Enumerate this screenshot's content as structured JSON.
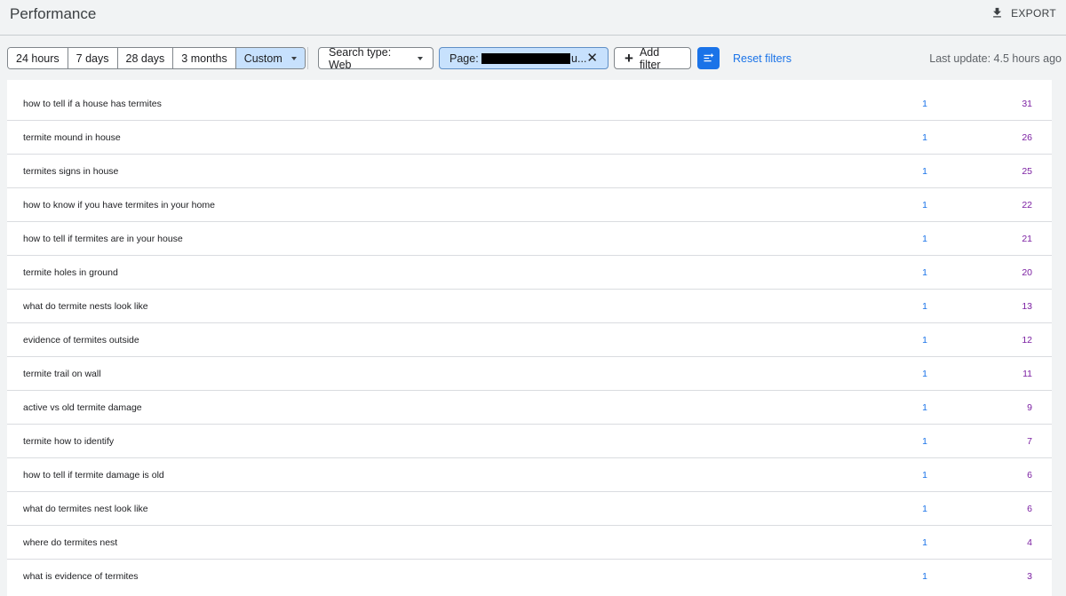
{
  "header": {
    "title": "Performance",
    "export_label": "EXPORT"
  },
  "filters": {
    "date_ranges": [
      {
        "label": "24 hours",
        "active": false
      },
      {
        "label": "7 days",
        "active": false
      },
      {
        "label": "28 days",
        "active": false
      },
      {
        "label": "3 months",
        "active": false
      },
      {
        "label": "Custom",
        "active": true
      }
    ],
    "search_type": "Search type: Web",
    "page_filter_prefix": "Page:",
    "page_filter_suffix": "u...",
    "add_filter_label": "Add filter",
    "reset_label": "Reset filters",
    "last_update": "Last update: 4.5 hours ago"
  },
  "colors": {
    "clicks": "#1a73e8",
    "impressions": "#7b1fa2",
    "active_chip": "#c7e1fd"
  },
  "queries": [
    {
      "query": "how to tell if a house has termites",
      "clicks": "1",
      "impressions": "31"
    },
    {
      "query": "termite mound in house",
      "clicks": "1",
      "impressions": "26"
    },
    {
      "query": "termites signs in house",
      "clicks": "1",
      "impressions": "25"
    },
    {
      "query": "how to know if you have termites in your home",
      "clicks": "1",
      "impressions": "22"
    },
    {
      "query": "how to tell if termites are in your house",
      "clicks": "1",
      "impressions": "21"
    },
    {
      "query": "termite holes in ground",
      "clicks": "1",
      "impressions": "20"
    },
    {
      "query": "what do termite nests look like",
      "clicks": "1",
      "impressions": "13"
    },
    {
      "query": "evidence of termites outside",
      "clicks": "1",
      "impressions": "12"
    },
    {
      "query": "termite trail on wall",
      "clicks": "1",
      "impressions": "11"
    },
    {
      "query": "active vs old termite damage",
      "clicks": "1",
      "impressions": "9"
    },
    {
      "query": "termite how to identify",
      "clicks": "1",
      "impressions": "7"
    },
    {
      "query": "how to tell if termite damage is old",
      "clicks": "1",
      "impressions": "6"
    },
    {
      "query": "what do termites nest look like",
      "clicks": "1",
      "impressions": "6"
    },
    {
      "query": "where do termites nest",
      "clicks": "1",
      "impressions": "4"
    },
    {
      "query": "what is evidence of termites",
      "clicks": "1",
      "impressions": "3"
    }
  ]
}
